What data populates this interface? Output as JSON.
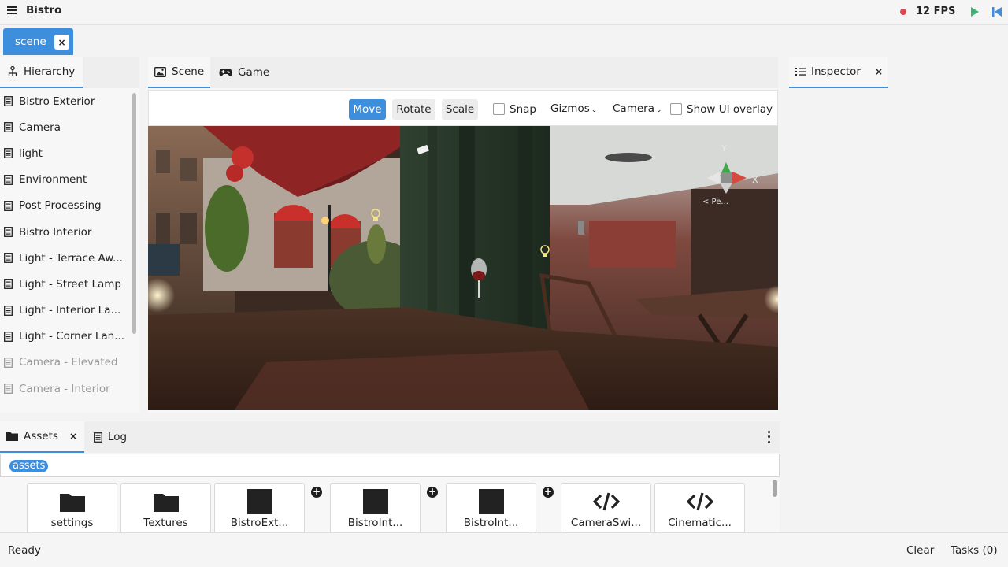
{
  "app": {
    "title": "Bistro",
    "fps": "12 FPS",
    "colors": {
      "accent": "#3e8ede",
      "record": "#d9484e",
      "play": "#3cb371"
    }
  },
  "document_tab": {
    "label": "scene",
    "close": "×"
  },
  "hierarchy": {
    "tab_label": "Hierarchy",
    "items": [
      {
        "label": "Bistro Exterior",
        "dim": false
      },
      {
        "label": "Camera",
        "dim": false
      },
      {
        "label": "light",
        "dim": false
      },
      {
        "label": "Environment",
        "dim": false
      },
      {
        "label": "Post Processing",
        "dim": false
      },
      {
        "label": "Bistro Interior",
        "dim": false
      },
      {
        "label": "Light - Terrace Aw...",
        "dim": false
      },
      {
        "label": "Light - Street Lamp",
        "dim": false
      },
      {
        "label": "Light - Interior La...",
        "dim": false
      },
      {
        "label": "Light - Corner Lan...",
        "dim": false
      },
      {
        "label": "Camera - Elevated",
        "dim": true
      },
      {
        "label": "Camera - Interior",
        "dim": true
      }
    ]
  },
  "center": {
    "tabs": [
      {
        "label": "Scene",
        "icon": "image-icon",
        "active": true
      },
      {
        "label": "Game",
        "icon": "gamepad-icon",
        "active": false
      }
    ],
    "toolbar": {
      "move": "Move",
      "rotate": "Rotate",
      "scale": "Scale",
      "snap": "Snap",
      "gizmos": "Gizmos",
      "camera": "Camera",
      "show_ui_overlay": "Show UI overlay"
    },
    "gizmo": {
      "y_label": "Y",
      "x_label": "X",
      "persp_label": "< Pe..."
    }
  },
  "inspector": {
    "tab_label": "Inspector",
    "close": "×"
  },
  "assets": {
    "tabs": [
      {
        "label": "Assets",
        "icon": "folder-icon",
        "active": true,
        "close": "×"
      },
      {
        "label": "Log",
        "icon": "document-icon",
        "active": false
      }
    ],
    "path": "assets",
    "items": [
      {
        "label": "settings",
        "icon": "folder-icon"
      },
      {
        "label": "Textures",
        "icon": "folder-icon"
      },
      {
        "label": "BistroExt...",
        "icon": "model-thumbnail-icon",
        "plus": true
      },
      {
        "label": "BistroInt...",
        "icon": "model-thumbnail-icon",
        "plus": true
      },
      {
        "label": "BistroInt...",
        "icon": "model-thumbnail-icon",
        "plus": true
      },
      {
        "label": "CameraSwi...",
        "icon": "code-icon"
      },
      {
        "label": "Cinematic...",
        "icon": "code-icon"
      }
    ]
  },
  "status": {
    "text": "Ready",
    "clear": "Clear",
    "tasks": "Tasks (0)"
  }
}
